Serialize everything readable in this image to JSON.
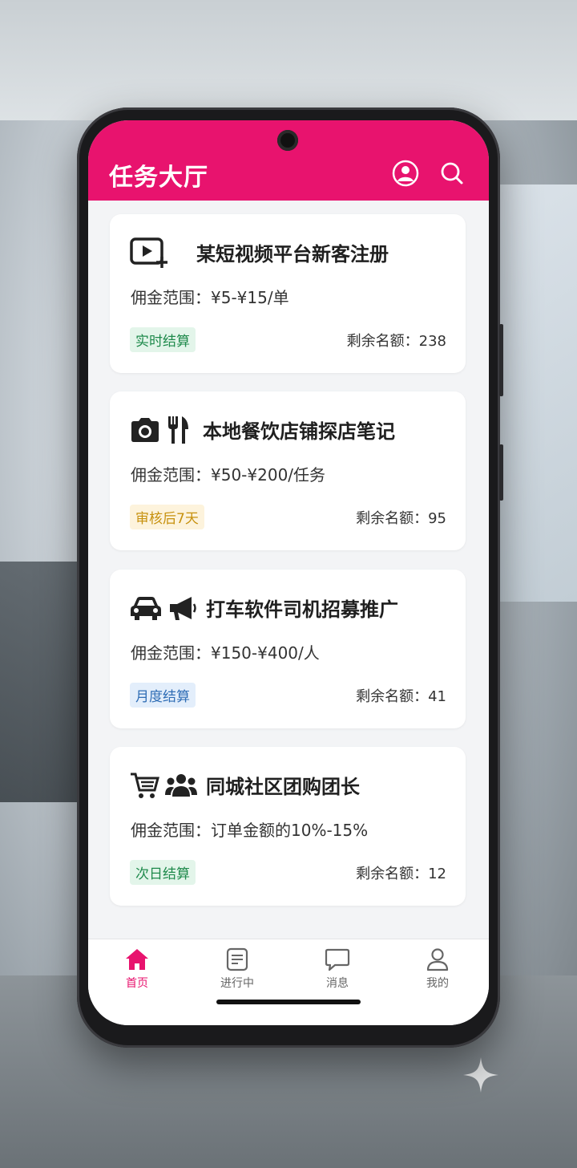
{
  "header": {
    "title": "任务大厅",
    "bg_color": "#e8136e",
    "icons": [
      "user-circle-icon",
      "search-icon"
    ]
  },
  "tasks": [
    {
      "icons": [
        "video-add-icon"
      ],
      "title": "某短视频平台新客注册",
      "commission": "佣金范围：¥5-¥15/单",
      "tag": "实时结算",
      "tag_color": "#1f8a4c",
      "tag_bg": "#e3f5ea",
      "remaining": "剩余名额：238"
    },
    {
      "icons": [
        "camera-icon",
        "utensils-icon"
      ],
      "title": "本地餐饮店铺探店笔记",
      "commission": "佣金范围：¥50-¥200/任务",
      "tag": "审核后7天",
      "tag_color": "#c7910e",
      "tag_bg": "#fdf3dc",
      "remaining": "剩余名额：95"
    },
    {
      "icons": [
        "car-icon",
        "megaphone-icon"
      ],
      "title": "打车软件司机招募推广",
      "commission": "佣金范围：¥150-¥400/人",
      "tag": "月度结算",
      "tag_color": "#2f6db5",
      "tag_bg": "#e3eefb",
      "remaining": "剩余名额：41"
    },
    {
      "icons": [
        "cart-icon",
        "group-icon"
      ],
      "title": "同城社区团购团长",
      "commission": "佣金范围：订单金额的10%-15%",
      "tag": "次日结算",
      "tag_color": "#1f8a4c",
      "tag_bg": "#e3f5ea",
      "remaining": "剩余名额：12"
    }
  ],
  "tabbar": {
    "active_color": "#e8136e",
    "items": [
      {
        "label": "首页",
        "icon": "home-icon",
        "active": true
      },
      {
        "label": "进行中",
        "icon": "document-icon",
        "active": false
      },
      {
        "label": "消息",
        "icon": "message-icon",
        "active": false
      },
      {
        "label": "我的",
        "icon": "profile-icon",
        "active": false
      }
    ]
  }
}
